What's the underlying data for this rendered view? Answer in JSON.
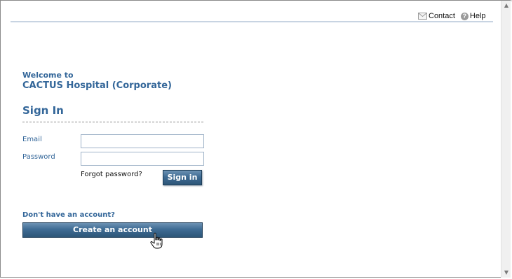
{
  "header": {
    "contact_label": "Contact",
    "help_label": "Help",
    "contact_icon": "mail-icon",
    "help_icon": "help-icon"
  },
  "welcome": {
    "line1": "Welcome to",
    "company": "CACTUS Hospital (Corporate)"
  },
  "signin": {
    "heading": "Sign In",
    "email_label": "Email",
    "email_value": "",
    "password_label": "Password",
    "password_value": "",
    "forgot_label": "Forgot password?",
    "button_label": "Sign in"
  },
  "register": {
    "prompt": "Don't have an account?",
    "button_label": "Create an account"
  },
  "colors": {
    "heading_blue": "#336699",
    "button_blue": "#3e6b93"
  }
}
